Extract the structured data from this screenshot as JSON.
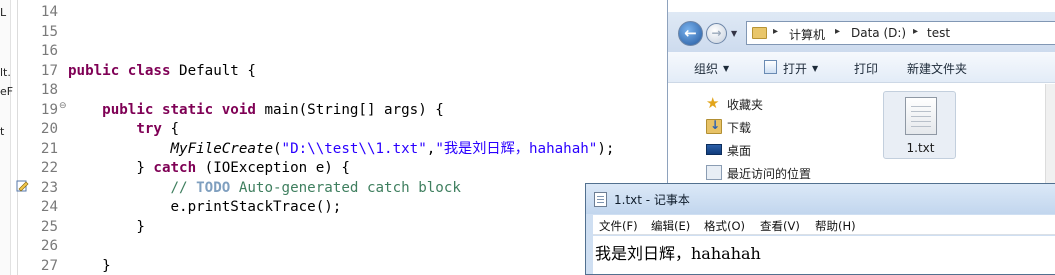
{
  "editor": {
    "left_fragments": [
      "L",
      "lt.",
      "eF",
      "t"
    ],
    "lines": [
      {
        "num": "14",
        "tokens": []
      },
      {
        "num": "15",
        "tokens": []
      },
      {
        "num": "16",
        "tokens": []
      },
      {
        "num": "17",
        "tokens": [
          [
            "kw",
            "public class"
          ],
          [
            "plain",
            " Default {"
          ]
        ]
      },
      {
        "num": "18",
        "tokens": []
      },
      {
        "num": "19",
        "tokens": [
          [
            "plain",
            "    "
          ],
          [
            "kw",
            "public static void"
          ],
          [
            "plain",
            " main(String[] args) {"
          ]
        ]
      },
      {
        "num": "20",
        "tokens": [
          [
            "plain",
            "        "
          ],
          [
            "kw",
            "try"
          ],
          [
            "plain",
            " {"
          ]
        ]
      },
      {
        "num": "21",
        "tokens": [
          [
            "plain",
            "            "
          ],
          [
            "it",
            "MyFileCreate"
          ],
          [
            "plain",
            "("
          ],
          [
            "str",
            "\"D:\\\\test\\\\1.txt\""
          ],
          [
            "plain",
            ","
          ],
          [
            "str",
            "\"我是刘日辉，hahahah\""
          ],
          [
            "plain",
            ");"
          ]
        ]
      },
      {
        "num": "22",
        "tokens": [
          [
            "plain",
            "        } "
          ],
          [
            "kw",
            "catch"
          ],
          [
            "plain",
            " (IOException e) {"
          ]
        ]
      },
      {
        "num": "23",
        "tokens": [
          [
            "plain",
            "            "
          ],
          [
            "cmt",
            "// "
          ],
          [
            "todo",
            "TODO"
          ],
          [
            "cmt",
            " Auto-generated catch block"
          ]
        ]
      },
      {
        "num": "24",
        "tokens": [
          [
            "plain",
            "            e.printStackTrace();"
          ]
        ]
      },
      {
        "num": "25",
        "tokens": [
          [
            "plain",
            "        }"
          ]
        ]
      },
      {
        "num": "26",
        "tokens": []
      },
      {
        "num": "27",
        "tokens": [
          [
            "plain",
            "    }"
          ]
        ]
      }
    ]
  },
  "explorer": {
    "breadcrumbs": [
      "计算机",
      "Data (D:)",
      "test"
    ],
    "toolbar": {
      "organize": "组织",
      "open": "打开",
      "print": "打印",
      "new_folder": "新建文件夹"
    },
    "nav_items": [
      {
        "label": "收藏夹",
        "icon": "star-icon"
      },
      {
        "label": "下载",
        "icon": "download-folder-icon"
      },
      {
        "label": "桌面",
        "icon": "desktop-icon"
      },
      {
        "label": "最近访问的位置",
        "icon": "recent-places-icon"
      }
    ],
    "file": {
      "name": "1.txt",
      "icon": "text-file-icon"
    }
  },
  "notepad": {
    "title": "1.txt - 记事本",
    "menus": [
      "文件(F)",
      "编辑(E)",
      "格式(O)",
      "查看(V)",
      "帮助(H)"
    ],
    "content": "我是刘日辉，hahahah"
  },
  "colors": {
    "keyword": "#7f0055",
    "string": "#2a00ff",
    "comment": "#3f7f5f",
    "todo": "#7f9fbf",
    "window_chrome": "#cfdff2"
  }
}
